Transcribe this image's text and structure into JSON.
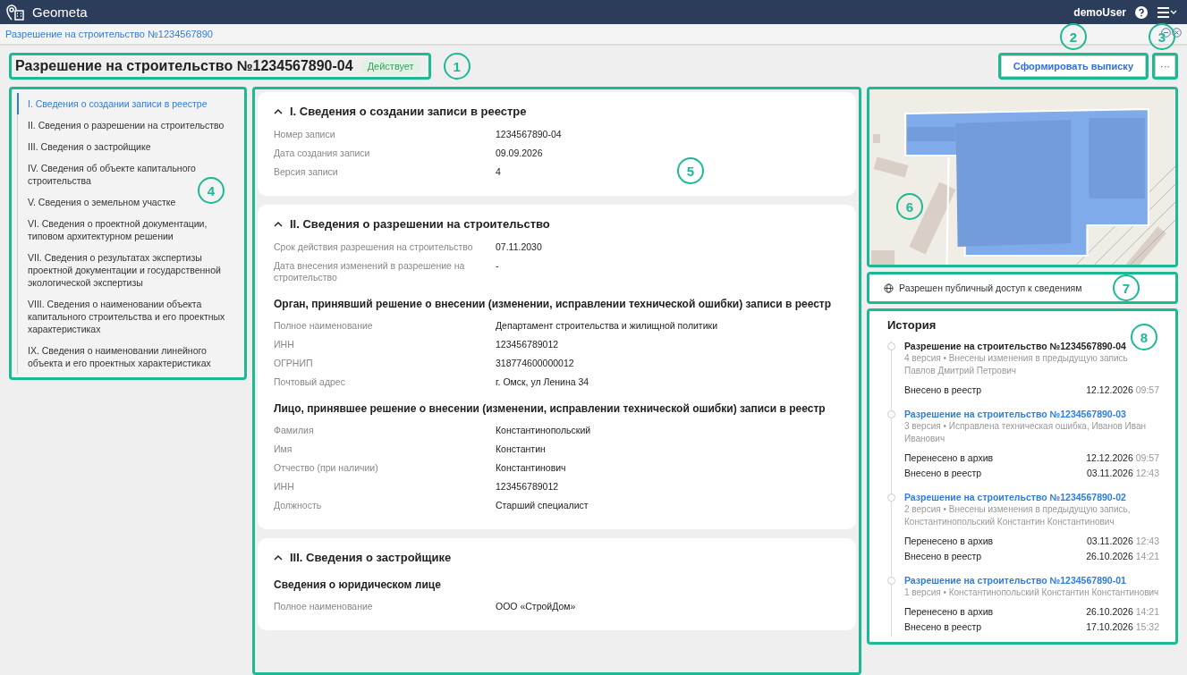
{
  "header": {
    "app_name": "Geometa",
    "user": "demoUser"
  },
  "breadcrumb": "Разрешение на строительство №1234567890",
  "title": {
    "text": "Разрешение на строительство №1234567890-04",
    "status": "Действует",
    "callout": "1"
  },
  "actions": {
    "primary": {
      "label": "Сформировать выписку",
      "callout": "2"
    },
    "more": {
      "label": "···",
      "callout": "3"
    }
  },
  "nav": {
    "callout": "4",
    "items": [
      {
        "label": "I. Сведения о создании записи в реестре",
        "selected": true
      },
      {
        "label": "II. Сведения о разрешении на строительство",
        "selected": false
      },
      {
        "label": "III. Сведения о застройщике",
        "selected": false
      },
      {
        "label": "IV. Сведения об объекте капитального строительства",
        "selected": false
      },
      {
        "label": "V. Сведения о земельном участке",
        "selected": false
      },
      {
        "label": "VI. Сведения о проектной документации, типовом архитектурном решении",
        "selected": false
      },
      {
        "label": "VII. Сведения о результатах экспертизы проектной документации и государственной экологической экспертизы",
        "selected": false
      },
      {
        "label": "VIII. Сведения о наименовании объекта капитального строительства и его проектных характеристиках",
        "selected": false
      },
      {
        "label": "IX. Сведения о наименовании линейного объекта и его проектных характеристиках",
        "selected": false
      }
    ]
  },
  "content": {
    "callout": "5",
    "sections": [
      {
        "title": "I. Сведения о создании записи в реестре",
        "expanded": true,
        "groups": [
          {
            "rows": [
              {
                "label": "Номер записи",
                "value": "1234567890-04"
              },
              {
                "label": "Дата создания записи",
                "value": "09.09.2026"
              },
              {
                "label": "Версия записи",
                "value": "4"
              }
            ]
          }
        ]
      },
      {
        "title": "II. Сведения о разрешении на строительство",
        "expanded": true,
        "groups": [
          {
            "rows": [
              {
                "label": "Срок действия разрешения на строительство",
                "value": "07.11.2030"
              },
              {
                "label": "Дата внесения изменений в разрешение на строительство",
                "value": "-"
              }
            ]
          },
          {
            "heading": "Орган, принявший решение о внесении (изменении, исправлении технической ошибки) записи в реестр",
            "rows": [
              {
                "label": "Полное наименование",
                "value": "Департамент строительства и жилищной политики"
              },
              {
                "label": "ИНН",
                "value": "123456789012"
              },
              {
                "label": "ОГРНИП",
                "value": "318774600000012"
              },
              {
                "label": "Почтовый адрес",
                "value": "г. Омск, ул Ленина 34"
              }
            ]
          },
          {
            "heading": "Лицо, принявшее решение о внесении (изменении, исправлении технической ошибки) записи в реестр",
            "rows": [
              {
                "label": "Фамилия",
                "value": "Константинопольский"
              },
              {
                "label": "Имя",
                "value": "Константин"
              },
              {
                "label": "Отчество (при наличии)",
                "value": "Константинович"
              },
              {
                "label": "ИНН",
                "value": "123456789012"
              },
              {
                "label": "Должность",
                "value": "Старший специалист"
              }
            ]
          }
        ]
      },
      {
        "title": "III. Сведения о застройщике",
        "expanded": true,
        "groups": [
          {
            "heading": "Сведения о юридическом лице",
            "rows": [
              {
                "label": "Полное наименование",
                "value": "ООО «СтройДом»"
              }
            ]
          }
        ]
      }
    ]
  },
  "map": {
    "callout": "6"
  },
  "public_access": {
    "text": "Разрешен публичный доступ к сведениям",
    "callout": "7"
  },
  "history": {
    "title": "История",
    "callout": "8",
    "items": [
      {
        "title": "Разрешение на строительство №1234567890-04",
        "kind": "current",
        "meta": "4 версия • Внесены изменения в предыдущую запись Павлов Дмитрий Петрович",
        "events": [
          {
            "label": "Внесено в реестр",
            "date": "12.12.2026",
            "time": "09:57"
          }
        ]
      },
      {
        "title": "Разрешение на строительство №1234567890-03",
        "kind": "link",
        "meta": "3 версия • Исправлена техническая ошибка, Иванов Иван Иванович",
        "events": [
          {
            "label": "Перенесено в архив",
            "date": "12.12.2026",
            "time": "09:57"
          },
          {
            "label": "Внесено в реестр",
            "date": "03.11.2026",
            "time": "12:43"
          }
        ]
      },
      {
        "title": "Разрешение на строительство №1234567890-02",
        "kind": "link",
        "meta": "2 версия • Внесены изменения в предыдущую запись, Константинопольский Константин Константинович",
        "events": [
          {
            "label": "Перенесено в архив",
            "date": "03.11.2026",
            "time": "12:43"
          },
          {
            "label": "Внесено в реестр",
            "date": "26.10.2026",
            "time": "14:21"
          }
        ]
      },
      {
        "title": "Разрешение на строительство №1234567890-01",
        "kind": "link",
        "meta": "1 версия • Константинопольский Константин Константинович",
        "events": [
          {
            "label": "Перенесено в архив",
            "date": "26.10.2026",
            "time": "14:21"
          },
          {
            "label": "Внесено в реестр",
            "date": "17.10.2026",
            "time": "15:32"
          }
        ]
      }
    ]
  }
}
